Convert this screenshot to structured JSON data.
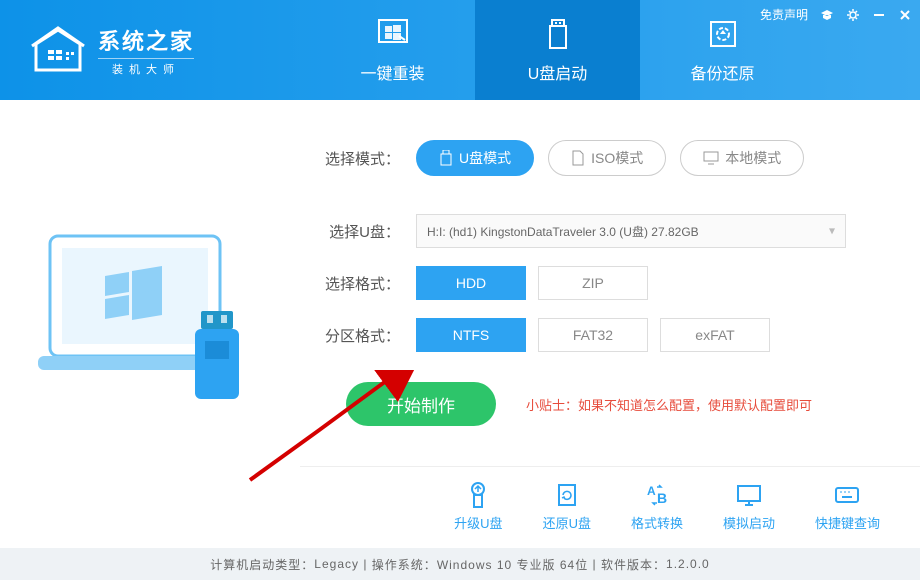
{
  "header": {
    "logo_title": "系统之家",
    "logo_sub": "装机大师",
    "disclaimer": "免责声明",
    "tabs": [
      {
        "label": "一键重装"
      },
      {
        "label": "U盘启动"
      },
      {
        "label": "备份还原"
      }
    ]
  },
  "panel": {
    "mode_label": "选择模式：",
    "modes": [
      {
        "label": "U盘模式",
        "active": true
      },
      {
        "label": "ISO模式",
        "active": false
      },
      {
        "label": "本地模式",
        "active": false
      }
    ],
    "drive_label": "选择U盘：",
    "drive_value": "H:I: (hd1) KingstonDataTraveler 3.0 (U盘) 27.82GB",
    "format_label": "选择格式：",
    "formats": [
      {
        "label": "HDD",
        "selected": true
      },
      {
        "label": "ZIP",
        "selected": false
      }
    ],
    "partition_label": "分区格式：",
    "partitions": [
      {
        "label": "NTFS",
        "selected": true
      },
      {
        "label": "FAT32",
        "selected": false
      },
      {
        "label": "exFAT",
        "selected": false
      }
    ],
    "start_label": "开始制作",
    "tip_label": "小贴士：",
    "tip_text": "如果不知道怎么配置，使用默认配置即可"
  },
  "tools": [
    {
      "label": "升级U盘"
    },
    {
      "label": "还原U盘"
    },
    {
      "label": "格式转换"
    },
    {
      "label": "模拟启动"
    },
    {
      "label": "快捷键查询"
    }
  ],
  "statusbar": {
    "boot_type_label": "计算机启动类型：",
    "boot_type": "Legacy",
    "os_label": "操作系统：",
    "os": "Windows 10 专业版 64位",
    "ver_label": "软件版本：",
    "ver": "1.2.0.0"
  }
}
